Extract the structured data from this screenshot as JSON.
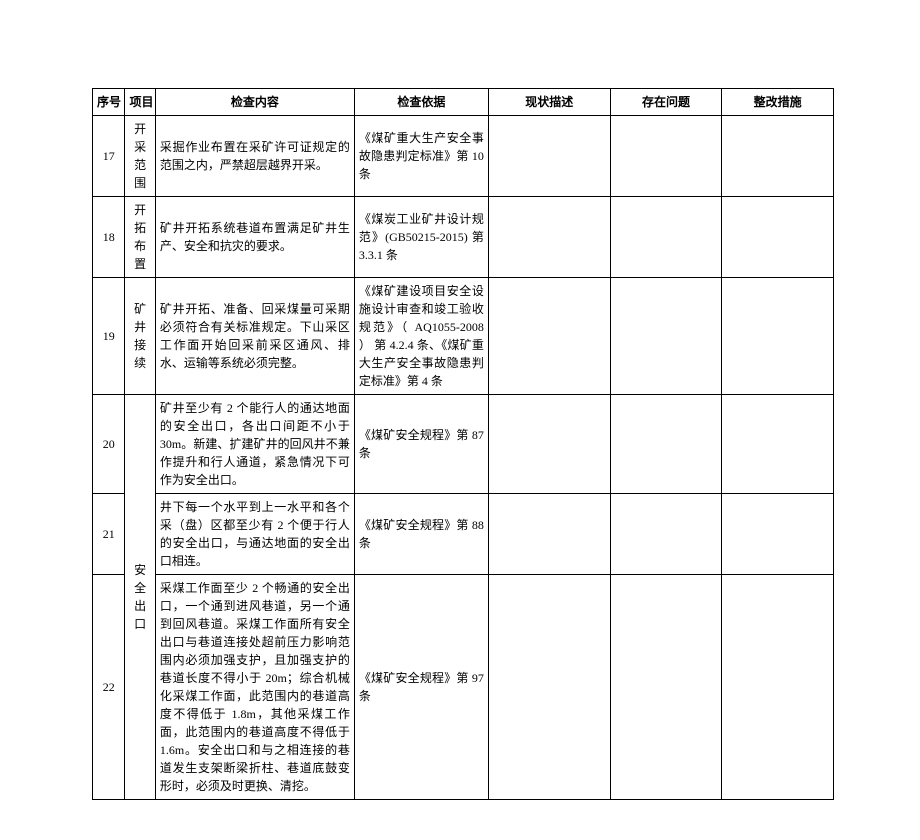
{
  "headers": {
    "num": "序号",
    "item": "项目",
    "check": "检查内容",
    "basis": "检查依据",
    "desc": "现状描述",
    "prob": "存在问题",
    "fix": "整改措施"
  },
  "row17": {
    "num": "17",
    "item": "开采范围",
    "check": "采掘作业布置在采矿许可证规定的范围之内，严禁超层越界开采。",
    "basis": "《煤矿重大生产安全事故隐患判定标准》第 10 条"
  },
  "row18": {
    "num": "18",
    "item": "开拓布置",
    "check": "矿井开拓系统巷道布置满足矿井生产、安全和抗灾的要求。",
    "basis": "《煤炭工业矿井设计规范》(GB50215-2015) 第 3.3.1 条"
  },
  "row19": {
    "num": "19",
    "item": "矿井接续",
    "check": "矿井开拓、准备、回采煤量可采期必须符合有关标准规定。下山采区工作面开始回采前采区通风、排水、运输等系统必须完整。",
    "basis": "《煤矿建设项目安全设施设计审查和竣工验收规范》（ AQ1055-2008 ） 第 4.2.4 条、《煤矿重大生产安全事故隐患判定标准》第 4 条"
  },
  "safety_exit_item": "安全出口",
  "row20": {
    "num": "20",
    "check": "矿井至少有 2 个能行人的通达地面的安全出口，各出口间距不小于 30m。新建、扩建矿井的回风井不兼作提升和行人通道，紧急情况下可作为安全出口。",
    "basis": "《煤矿安全规程》第 87 条"
  },
  "row21": {
    "num": "21",
    "check": "井下每一个水平到上一水平和各个采（盘）区都至少有 2 个便于行人的安全出口，与通达地面的安全出口相连。",
    "basis": "《煤矿安全规程》第 88 条"
  },
  "row22": {
    "num": "22",
    "check": "采煤工作面至少 2 个畅通的安全出口，一个通到进风巷道，另一个通到回风巷道。采煤工作面所有安全出口与巷道连接处超前压力影响范围内必须加强支护，且加强支护的巷道长度不得小于 20m；综合机械化采煤工作面，此范围内的巷道高度不得低于 1.8m，其他采煤工作面，此范围内的巷道高度不得低于 1.6m。安全出口和与之相连接的巷道发生支架断梁折柱、巷道底鼓变形时，必须及时更换、清挖。",
    "basis": "《煤矿安全规程》第 97 条"
  }
}
